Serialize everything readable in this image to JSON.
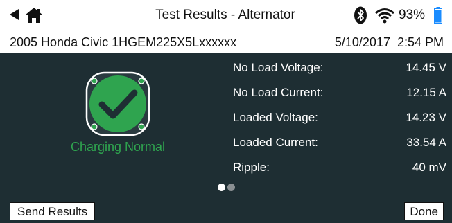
{
  "header": {
    "back_icon": "back-arrow-icon",
    "home_icon": "home-icon",
    "title": "Test Results - Alternator",
    "bluetooth_icon": "bluetooth-icon",
    "wifi_icon": "wifi-icon",
    "battery_percent": "93%",
    "battery_level": 0.93,
    "battery_color": "#1a8cff"
  },
  "info": {
    "vehicle": "2005 Honda Civic 1HGEM225X5Lxxxxxx",
    "datetime": "5/10/2017  2:54 PM"
  },
  "status": {
    "icon": "check-badge-icon",
    "text": "Charging Normal",
    "color": "#2fa44f"
  },
  "readings": [
    {
      "label": "No Load Voltage:",
      "value": "14.45 V"
    },
    {
      "label": "No Load Current:",
      "value": "12.15 A"
    },
    {
      "label": "Loaded Voltage:",
      "value": "14.23 V"
    },
    {
      "label": "Loaded Current:",
      "value": "33.54 A"
    },
    {
      "label": "Ripple:",
      "value": "40 mV"
    }
  ],
  "pager": {
    "current_page": 1,
    "total_pages": 2
  },
  "buttons": {
    "send": "Send Results",
    "done": "Done"
  }
}
